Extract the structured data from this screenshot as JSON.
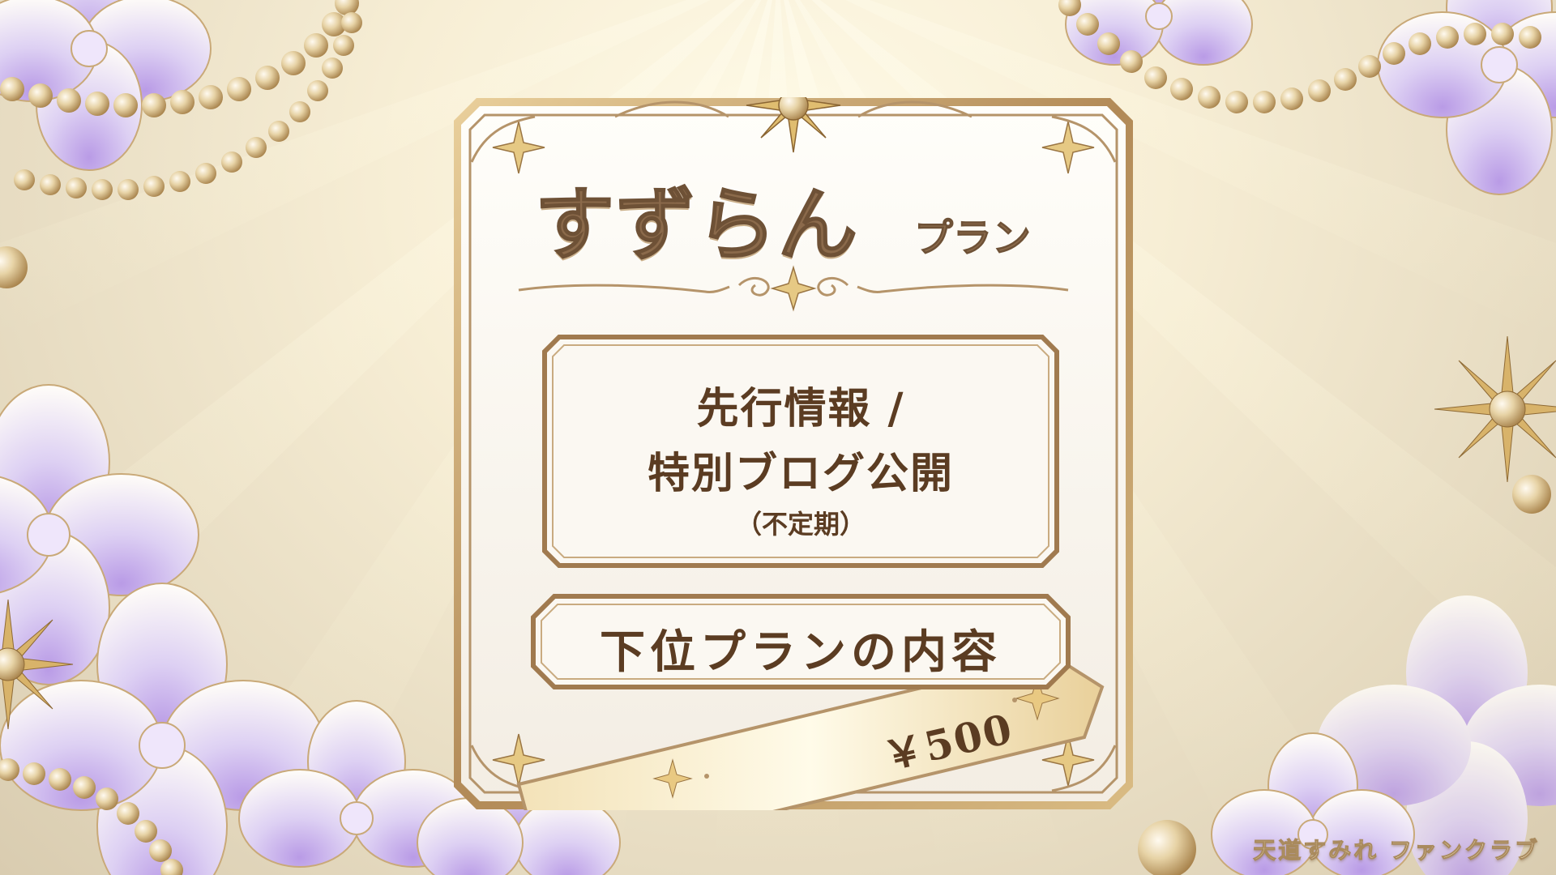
{
  "plan": {
    "title": "すずらん",
    "title_suffix": "プラン"
  },
  "benefits": {
    "line1": "先行情報 /",
    "line2": "特別ブログ公開",
    "note": "（不定期）"
  },
  "lower_plan": {
    "label": "下位プランの内容"
  },
  "price": {
    "label": "￥500"
  },
  "brand": {
    "label": "天道すみれ ファンクラブ"
  },
  "colors": {
    "frame_gold": "#b5946a",
    "text_brown": "#5b3c22",
    "title_brown": "#8b6a4b",
    "flower_lilac": "#c9b2ea",
    "pearl_gold": "#d6ba83"
  }
}
